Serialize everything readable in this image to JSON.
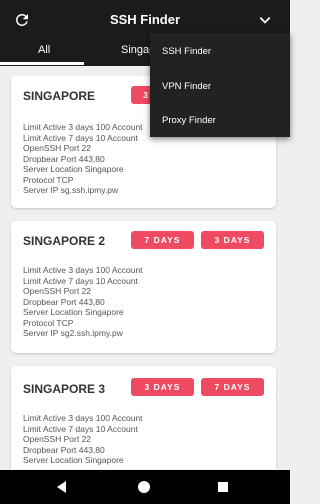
{
  "app": {
    "title": "SSH Finder",
    "refresh_icon": "refresh-icon",
    "dropdown_icon": "chevron-down-icon"
  },
  "tabs": [
    {
      "label": "All"
    },
    {
      "label": "Singapo"
    }
  ],
  "menu": {
    "items": [
      {
        "label": "SSH Finder"
      },
      {
        "label": "VPN Finder"
      },
      {
        "label": "Proxy Finder"
      }
    ]
  },
  "cards": [
    {
      "title": "SINGAPORE",
      "badges": [
        "3"
      ],
      "lines": [
        "Limit Active 3 days 100 Account",
        "Limit Active 7 days 10 Account",
        "OpenSSH Port 22",
        "Dropbear Port 443,80",
        "Server Location Singapore",
        "Protocol TCP",
        "Server IP sg.ssh.ipmy.pw"
      ]
    },
    {
      "title": "SINGAPORE 2",
      "badges": [
        "7 DAYS",
        "3 DAYS"
      ],
      "lines": [
        "Limit Active 3 days 100 Account",
        "Limit Active 7 days 10 Account",
        "OpenSSH Port 22",
        "Dropbear Port 443,80",
        "Server Location Singapore",
        "Protocol TCP",
        "Server IP sg2.ssh.ipmy.pw"
      ]
    },
    {
      "title": "SINGAPORE 3",
      "badges": [
        "3 DAYS",
        "7 DAYS"
      ],
      "lines": [
        "Limit Active 3 days 100 Account",
        "Limit Active 7 days 10 Account",
        "OpenSSH Port 22",
        "Dropbear Port 443,80",
        "Server Location Singapore"
      ]
    }
  ],
  "colors": {
    "appbar": "#1b1b1b",
    "badge": "#ee4a62",
    "background": "#efefef"
  }
}
